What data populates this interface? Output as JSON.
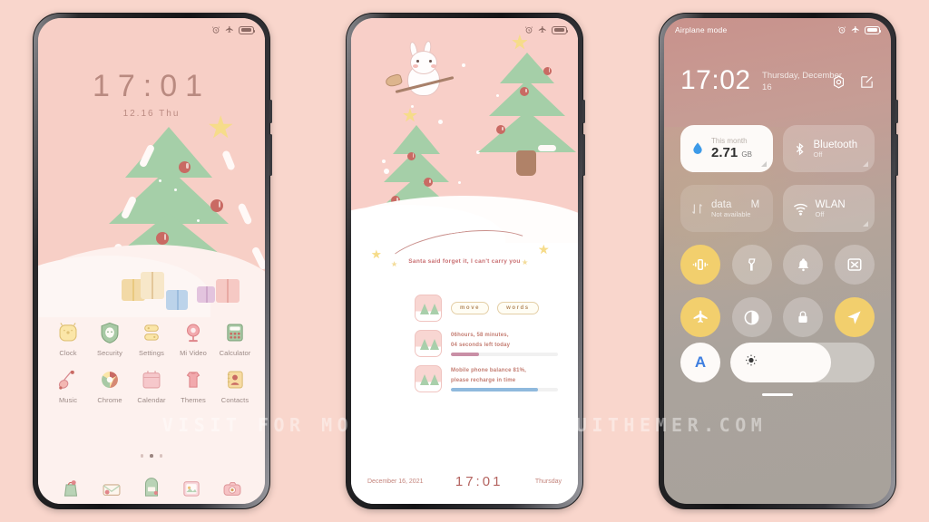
{
  "background_color": "#f9d6cc",
  "watermark": "VISIT FOR MORE THEMES - MIUITHEMER.COM",
  "phone1": {
    "name": "home-screen",
    "statusbar": {
      "alarm_icon": "alarm-icon",
      "airplane_icon": "airplane-icon",
      "battery_icon": "battery-icon"
    },
    "clock": "17:01",
    "date": "12.16 Thu",
    "apps_row1": [
      {
        "label": "Clock",
        "icon": "clock-icon"
      },
      {
        "label": "Security",
        "icon": "security-icon"
      },
      {
        "label": "Settings",
        "icon": "settings-icon"
      },
      {
        "label": "Mi Video",
        "icon": "mi-video-icon"
      },
      {
        "label": "Calculator",
        "icon": "calculator-icon"
      }
    ],
    "apps_row2": [
      {
        "label": "Music",
        "icon": "music-icon"
      },
      {
        "label": "Chrome",
        "icon": "chrome-icon"
      },
      {
        "label": "Calendar",
        "icon": "calendar-icon"
      },
      {
        "label": "Themes",
        "icon": "themes-icon"
      },
      {
        "label": "Contacts",
        "icon": "contacts-icon"
      }
    ],
    "page_dots": 3,
    "active_dot": 2,
    "dock": [
      {
        "icon": "gallery-bag-icon"
      },
      {
        "icon": "mail-icon"
      },
      {
        "icon": "files-icon"
      },
      {
        "icon": "photos-icon"
      },
      {
        "icon": "camera-icon"
      }
    ]
  },
  "phone2": {
    "name": "secondary-home-screen",
    "statusbar": {
      "alarm_icon": "alarm-icon",
      "airplane_icon": "airplane-icon",
      "battery_icon": "battery-icon"
    },
    "banner_text": "Santa said forget it, I can't carry you",
    "pills": [
      "move",
      "words"
    ],
    "widget_countdown_line1": "06hours, 58 minutes,",
    "widget_countdown_line2": "04 seconds left today",
    "widget_balance_line1": "Mobile phone balance 81%,",
    "widget_balance_line2": "please recharge in time",
    "countdown_progress": 26,
    "balance_progress": 81,
    "countdown_bar_color": "#c98fa6",
    "balance_bar_color": "#8fb9dd",
    "footer_date": "December 16, 2021",
    "footer_time": "17:01",
    "footer_day": "Thursday"
  },
  "phone3": {
    "name": "control-center",
    "statusbar": {
      "left_text": "Airplane mode",
      "alarm_icon": "alarm-icon",
      "airplane_icon": "airplane-icon",
      "battery_icon": "battery-icon"
    },
    "time": "17:02",
    "date": "Thursday, December 16",
    "head_icons": [
      {
        "icon": "settings-gear-icon"
      },
      {
        "icon": "edit-icon"
      }
    ],
    "tiles": [
      {
        "name": "data-usage-tile",
        "title": "This month",
        "value": "2.71",
        "unit": "GB",
        "icon": "water-drop-icon",
        "active": true
      },
      {
        "name": "bluetooth-tile",
        "title": "Bluetooth",
        "sub": "Off",
        "icon": "bluetooth-icon",
        "active": false
      },
      {
        "name": "mobile-data-tile",
        "title": "data",
        "title2": "M",
        "sub": "Not available",
        "icon": "data-arrows-icon",
        "active": false
      },
      {
        "name": "wlan-tile",
        "title": "WLAN",
        "sub": "Off",
        "icon": "wifi-icon",
        "active": false
      }
    ],
    "toggles_row1": [
      {
        "name": "vibrate-toggle",
        "icon": "vibrate-icon",
        "on": true
      },
      {
        "name": "flashlight-toggle",
        "icon": "flashlight-icon",
        "on": false
      },
      {
        "name": "ringer-toggle",
        "icon": "bell-icon",
        "on": false
      },
      {
        "name": "screenshot-toggle",
        "icon": "screenshot-icon",
        "on": false
      }
    ],
    "toggles_row2": [
      {
        "name": "airplane-toggle",
        "icon": "airplane-icon",
        "on": true
      },
      {
        "name": "dark-mode-toggle",
        "icon": "contrast-icon",
        "on": false
      },
      {
        "name": "lock-toggle",
        "icon": "lock-icon",
        "on": false
      },
      {
        "name": "location-toggle",
        "icon": "location-arrow-icon",
        "on": true
      }
    ],
    "auto_brightness_label": "A",
    "brightness_percent": 70,
    "brightness_icon": "sun-icon"
  }
}
